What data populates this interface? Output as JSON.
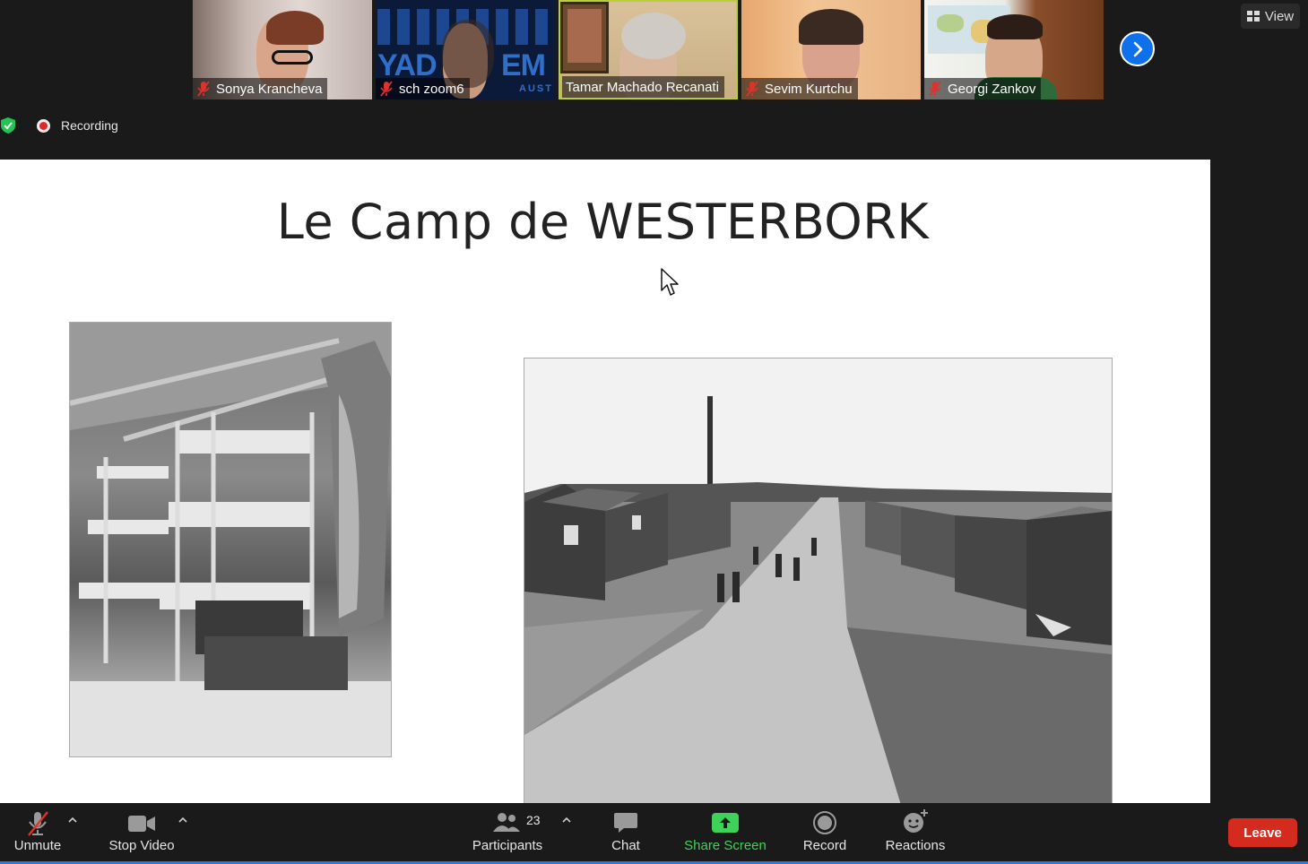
{
  "gallery": {
    "participants": [
      {
        "name": "Sonya Krancheva",
        "muted": true,
        "active": false
      },
      {
        "name": "sch zoom6",
        "muted": true,
        "active": false
      },
      {
        "name": "Tamar Machado Recanati",
        "muted": false,
        "active": true
      },
      {
        "name": "Sevim Kurtchu",
        "muted": true,
        "active": false
      },
      {
        "name": "Georgi Zankov",
        "muted": true,
        "active": false
      }
    ],
    "banner_text_1": "YAD V",
    "banner_text_2": "EM",
    "banner_text_3": "AUST"
  },
  "view_button": {
    "label": "View"
  },
  "status": {
    "recording_label": "Recording"
  },
  "slide": {
    "title": "Le Camp de WESTERBORK"
  },
  "toolbar": {
    "unmute": "Unmute",
    "stop_video": "Stop Video",
    "participants": "Participants",
    "participants_count": "23",
    "chat": "Chat",
    "share_screen": "Share Screen",
    "record": "Record",
    "reactions": "Reactions",
    "leave": "Leave"
  },
  "colors": {
    "accent_blue": "#0e71eb",
    "share_green": "#3fd25a",
    "leave_red": "#d52b1e",
    "muted_red": "#e0312b",
    "active_speaker": "#b8cf3a"
  }
}
